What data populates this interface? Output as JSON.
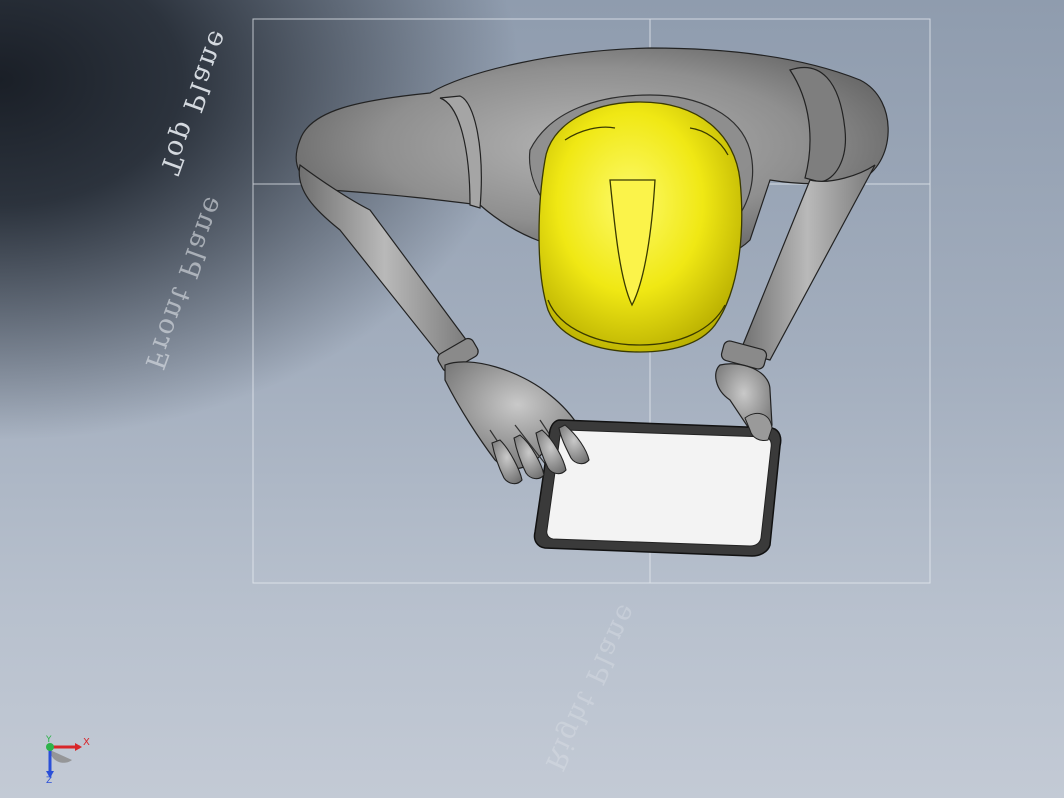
{
  "planes": {
    "top": "Top Plane",
    "front": "Front Plane",
    "right": "Right Plane"
  },
  "triad": {
    "x": "X",
    "y": "Y",
    "z": "Z"
  },
  "colors": {
    "helmet": "#f2ea14",
    "body": "#9a9a9a",
    "tablet_screen": "#f2f2f2",
    "x_axis": "#d8262a",
    "y_axis": "#2db34a",
    "z_axis": "#2a4fd8"
  }
}
